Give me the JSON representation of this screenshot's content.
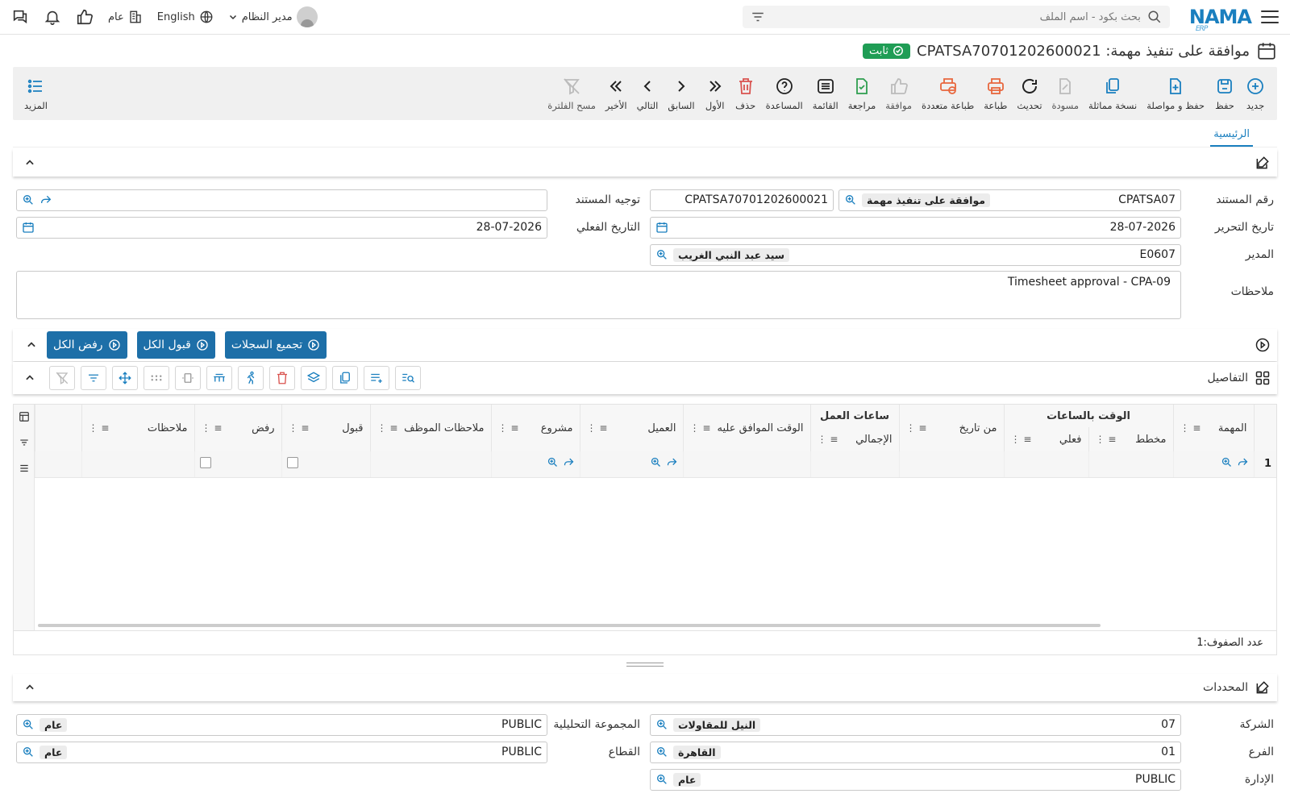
{
  "header": {
    "logo": "NAMA",
    "logo_sub": "ERP",
    "search_placeholder": "بحث بكود - اسم الملف",
    "language": "English",
    "branch": "عام",
    "user": "مدير النظام"
  },
  "page": {
    "title": "موافقة على تنفيذ مهمة: CPATSA70701202600021",
    "status": "ثابت"
  },
  "toolbar": {
    "items": [
      {
        "label": "جديد"
      },
      {
        "label": "حفظ"
      },
      {
        "label": "حفظ و مواصلة"
      },
      {
        "label": "نسخة مماثلة"
      },
      {
        "label": "مسودة"
      },
      {
        "label": "تحديث"
      },
      {
        "label": "طباعة"
      },
      {
        "label": "طباعة متعددة"
      },
      {
        "label": "موافقة"
      },
      {
        "label": "مراجعة"
      },
      {
        "label": "القائمة"
      },
      {
        "label": "المساعدة"
      },
      {
        "label": "حذف"
      },
      {
        "label": "الأول"
      },
      {
        "label": "السابق"
      },
      {
        "label": "التالي"
      },
      {
        "label": "الأخير"
      },
      {
        "label": "مسح الفلترة"
      }
    ],
    "more": "المزيد"
  },
  "tabs": {
    "main": "الرئيسية"
  },
  "form": {
    "doc_number_label": "رقم المستند",
    "doc_book_code": "CPATSA07",
    "doc_book_name": "موافقة على تنفيذ مهمة",
    "doc_number": "CPATSA70701202600021",
    "doc_route_label": "توجيه المستند",
    "doc_route": "",
    "edit_date_label": "تاريخ التحرير",
    "edit_date": "28-07-2026",
    "actual_date_label": "التاريخ الفعلي",
    "actual_date": "28-07-2026",
    "manager_label": "المدير",
    "manager_code": "E0607",
    "manager_name": "سيد عبد النبي الغريب",
    "notes_label": "ملاحظات",
    "notes": "Timesheet approval - CPA-09"
  },
  "actions": {
    "collect": "تجميع السجلات",
    "accept_all": "قبول الكل",
    "reject_all": "رفض الكل"
  },
  "details": {
    "title": "التفاصيل",
    "columns": {
      "task": "المهمة",
      "time_hours": "الوقت بالساعات",
      "planned": "مخطط",
      "actual": "فعلي",
      "from_date": "من تاريخ",
      "work_hours": "ساعات العمل",
      "total": "الإجمالي",
      "approved_time": "الوقت الموافق عليه",
      "customer": "العميل",
      "project": "مشروع",
      "emp_notes": "ملاحظات الموظف",
      "accept": "قبول",
      "reject": "رفض",
      "notes": "ملاحظات"
    },
    "rows": [
      {
        "num": "1"
      }
    ],
    "row_count_label": "عدد الصفوف:",
    "row_count": "1"
  },
  "dimensions": {
    "title": "المحددات",
    "company_label": "الشركة",
    "company_code": "07",
    "company_name": "النيل للمقاولات",
    "analytic_label": "المجموعة التحليلية",
    "analytic_code": "PUBLIC",
    "analytic_name": "عام",
    "branch_label": "الفرع",
    "branch_code": "01",
    "branch_name": "القاهرة",
    "sector_label": "القطاع",
    "sector_code": "PUBLIC",
    "sector_name": "عام",
    "dept_label": "الإدارة",
    "dept_code": "PUBLIC",
    "dept_name": "عام"
  },
  "colors": {
    "accent": "#1a7fbf",
    "button": "#1d6fa8",
    "status": "#1f9d55",
    "danger": "#d9534f",
    "print": "#e8663d",
    "approve": "#2e9e4f"
  }
}
